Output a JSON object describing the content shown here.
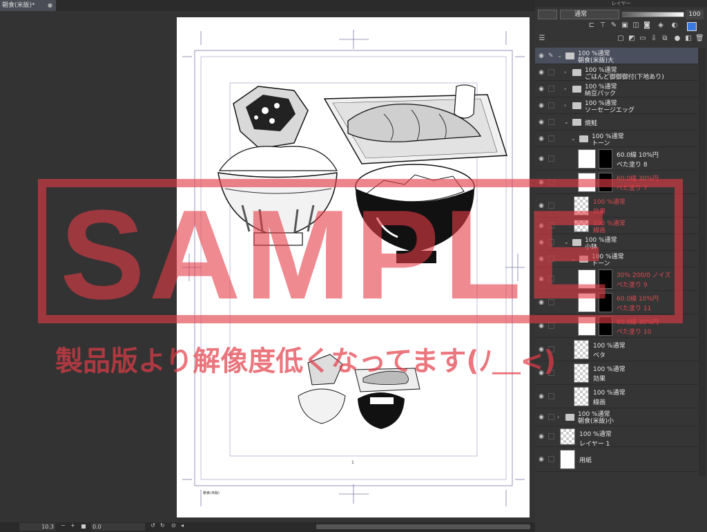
{
  "document_tab": {
    "title": "朝食(米飯)*",
    "close": "●"
  },
  "panel": {
    "title": "レイヤー",
    "blend_mode": "通常",
    "opacity": "100"
  },
  "page": {
    "page_number": "1",
    "footer_label": "朝食(米飯)"
  },
  "status": {
    "zoom": "10.3",
    "rotation": "0.0",
    "minus": "−",
    "plus": "+"
  },
  "watermark": {
    "main": "SAMPLE",
    "sub": "製品版より解像度低くなってます(ﾉ＿<)"
  },
  "layers": [
    {
      "line1": "100 %通常",
      "line2": "朝食(米飯)大",
      "type": "folder",
      "indent": 0,
      "open": true,
      "selected": true,
      "pen": true
    },
    {
      "line1": "100 %通常",
      "line2": "ごはんど御御御付(下地あり)",
      "type": "folder",
      "indent": 1,
      "open": false
    },
    {
      "line1": "100 %通常",
      "line2": "納豆パック",
      "type": "folder",
      "indent": 1,
      "open": false
    },
    {
      "line1": "100 %通常",
      "line2": "ソーセージエッグ",
      "type": "folder",
      "indent": 1,
      "open": false
    },
    {
      "line1": "",
      "line2": "焼鮭",
      "type": "folder",
      "indent": 1,
      "open": true
    },
    {
      "line1": "100 %通常",
      "line2": "トーン",
      "type": "folder",
      "indent": 2,
      "open": true
    },
    {
      "line1": "60.0線 10%円",
      "line2": "ベた塗り 8",
      "type": "tone",
      "indent": 3
    },
    {
      "line1": "60.0線 30%円",
      "line2": "ベた塗り 7",
      "type": "tone",
      "indent": 3
    },
    {
      "line1": "100 %通常",
      "line2": "効果",
      "type": "layer",
      "indent": 2
    },
    {
      "line1": "100 %通常",
      "line2": "線画",
      "type": "layer",
      "indent": 2
    },
    {
      "line1": "100 %通常",
      "line2": "小鉢",
      "type": "folder",
      "indent": 1,
      "open": true
    },
    {
      "line1": "100 %通常",
      "line2": "トーン",
      "type": "folder",
      "indent": 2,
      "open": true
    },
    {
      "line1": "30% 200/0 ノイズ",
      "line2": "ベた塗り 9",
      "type": "tone",
      "indent": 3
    },
    {
      "line1": "60.0線 10%円",
      "line2": "ベた塗り 11",
      "type": "tone",
      "indent": 3
    },
    {
      "line1": "60.0線 30%円",
      "line2": "ベた塗り 10",
      "type": "tone",
      "indent": 3
    },
    {
      "line1": "100 %通常",
      "line2": "ベタ",
      "type": "layer",
      "indent": 2
    },
    {
      "line1": "100 %通常",
      "line2": "効果",
      "type": "layer",
      "indent": 2
    },
    {
      "line1": "100 %通常",
      "line2": "線画",
      "type": "layer",
      "indent": 2
    },
    {
      "line1": "100 %通常",
      "line2": "朝食(米飯)小",
      "type": "folder",
      "indent": 0,
      "open": false
    },
    {
      "line1": "100 %通常",
      "line2": "レイヤー 1",
      "type": "layer",
      "indent": 0
    },
    {
      "line1": "",
      "line2": "用紙",
      "type": "paper",
      "indent": 0
    }
  ]
}
